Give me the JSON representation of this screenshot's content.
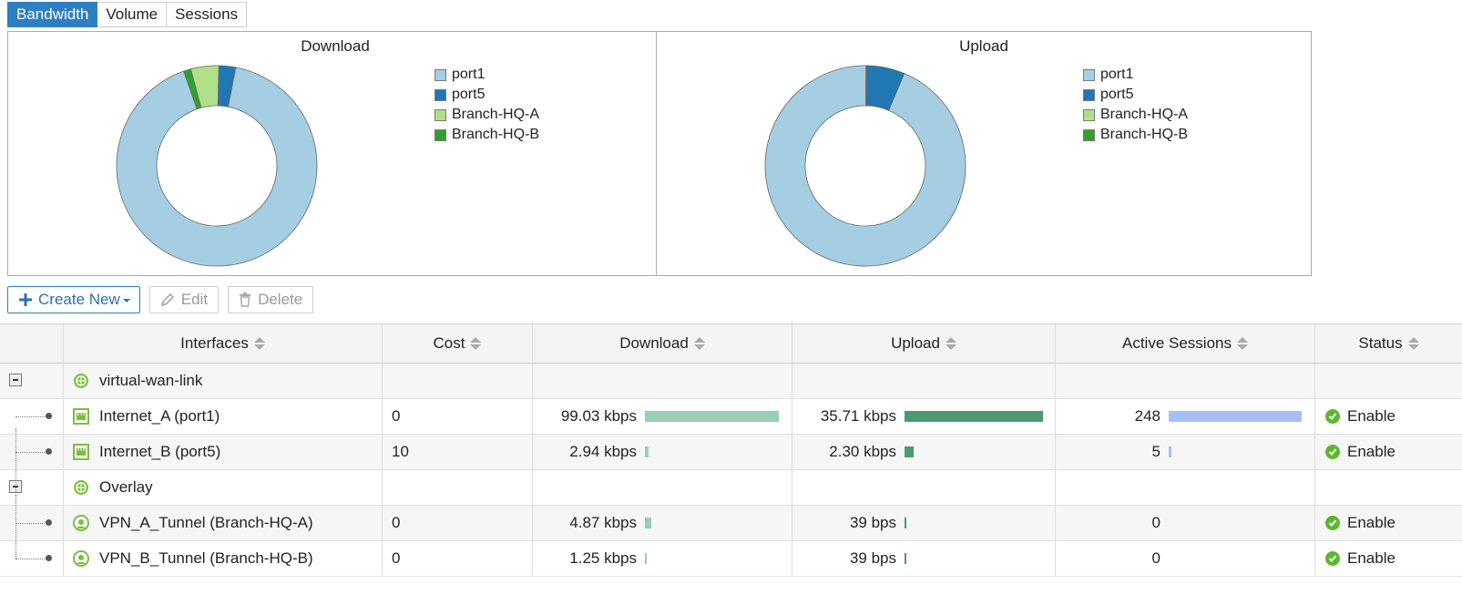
{
  "tabs": [
    "Bandwidth",
    "Volume",
    "Sessions"
  ],
  "legend_items": [
    {
      "name": "port1",
      "color": "#a6cee3"
    },
    {
      "name": "port5",
      "color": "#1f78b4"
    },
    {
      "name": "Branch-HQ-A",
      "color": "#b2df8a"
    },
    {
      "name": "Branch-HQ-B",
      "color": "#33a02c"
    }
  ],
  "chart_data": [
    {
      "type": "pie",
      "title": "Download",
      "labels": [
        "port1",
        "port5",
        "Branch-HQ-A",
        "Branch-HQ-B"
      ],
      "values": [
        99.03,
        2.94,
        4.87,
        1.25
      ]
    },
    {
      "type": "pie",
      "title": "Upload",
      "labels": [
        "port1",
        "port5",
        "Branch-HQ-A",
        "Branch-HQ-B"
      ],
      "values": [
        35.71,
        2.3,
        0.039,
        0.039
      ]
    }
  ],
  "toolbar": {
    "create_label": "Create New",
    "edit_label": "Edit",
    "delete_label": "Delete"
  },
  "columns": [
    "Interfaces",
    "Cost",
    "Download",
    "Upload",
    "Active Sessions",
    "Status"
  ],
  "bar_colors": {
    "download": "#99cdb4",
    "upload": "#4a9a6e",
    "sessions": "#a5c0f0"
  },
  "rows": [
    {
      "kind": "group",
      "name": "virtual-wan-link"
    },
    {
      "kind": "member",
      "name": "Internet_A (port1)",
      "cost": "0",
      "download": "99.03 kbps",
      "download_frac": 1.0,
      "upload": "35.71 kbps",
      "upload_frac": 1.0,
      "sessions": "248",
      "sessions_frac": 1.0,
      "status": "Enable"
    },
    {
      "kind": "member",
      "name": "Internet_B (port5)",
      "cost": "10",
      "download": "2.94 kbps",
      "download_frac": 0.03,
      "upload": "2.30 kbps",
      "upload_frac": 0.064,
      "sessions": "5",
      "sessions_frac": 0.02,
      "status": "Enable"
    },
    {
      "kind": "group",
      "name": "Overlay"
    },
    {
      "kind": "member",
      "name": "VPN_A_Tunnel (Branch-HQ-A)",
      "cost": "0",
      "download": "4.87 kbps",
      "download_frac": 0.049,
      "upload": "39 bps",
      "upload_frac": 0.011,
      "sessions": "0",
      "sessions_frac": 0,
      "status": "Enable"
    },
    {
      "kind": "member",
      "name": "VPN_B_Tunnel (Branch-HQ-B)",
      "cost": "0",
      "download": "1.25 kbps",
      "download_frac": 0.013,
      "upload": "39 bps",
      "upload_frac": 0.011,
      "sessions": "0",
      "sessions_frac": 0,
      "status": "Enable"
    }
  ]
}
